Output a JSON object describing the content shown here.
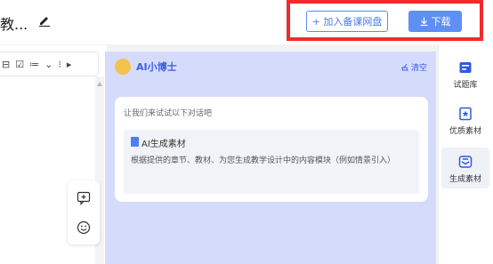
{
  "header": {
    "doc_title": "教...",
    "add_to_disk_label": "+ 加入备课网盘",
    "download_label": "下载"
  },
  "editor_toolbar": {
    "items": [
      "⊟",
      "☑",
      "≔",
      "⌄",
      "⁝",
      "▸"
    ]
  },
  "chat": {
    "assistant_name": "AI小博士",
    "clear_label": "清空",
    "intro": "让我们来试试以下对话吧",
    "suggestion": {
      "title": "AI生成素材",
      "description": "根据提供的章节、教材、为您生成教学设计中的内容模块（例如情景引入）"
    }
  },
  "sidebar": {
    "items": [
      {
        "label": "试题库",
        "icon": "question-bank-icon"
      },
      {
        "label": "优质素材",
        "icon": "star-material-icon"
      },
      {
        "label": "生成素材",
        "icon": "generate-material-icon",
        "active": true
      }
    ]
  },
  "colors": {
    "accent": "#5f8ff5",
    "highlight_border": "#f02b2b",
    "chat_bg": "#d5dcfb"
  }
}
